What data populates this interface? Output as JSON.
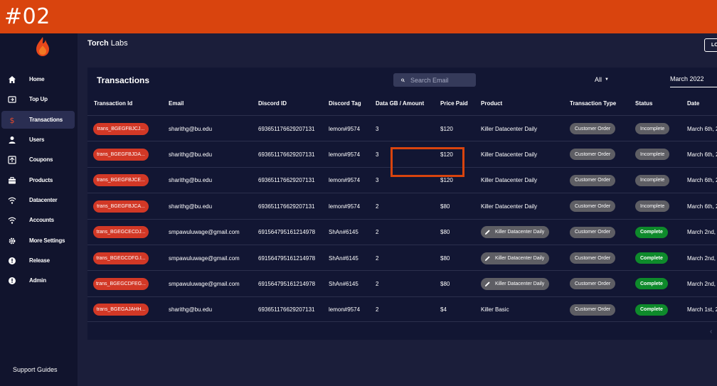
{
  "step_label": "#02",
  "brand": {
    "bold": "Torch",
    "rest": " Labs"
  },
  "logout_label": "LO",
  "sidebar": {
    "items": [
      {
        "label": "Home",
        "icon": "home-icon",
        "active": false
      },
      {
        "label": "Top Up",
        "icon": "topup-icon",
        "active": false
      },
      {
        "label": "Transactions",
        "icon": "dollar-icon",
        "active": true
      },
      {
        "label": "Users",
        "icon": "user-icon",
        "active": false
      },
      {
        "label": "Coupons",
        "icon": "coupon-icon",
        "active": false
      },
      {
        "label": "Products",
        "icon": "briefcase-icon",
        "active": false
      },
      {
        "label": "Datacenter",
        "icon": "wifi-icon",
        "active": false
      },
      {
        "label": "Accounts",
        "icon": "wifi-icon",
        "active": false
      },
      {
        "label": "More Settings",
        "icon": "gear-icon",
        "active": false
      },
      {
        "label": "Release",
        "icon": "alert-icon",
        "active": false
      },
      {
        "label": "Admin",
        "icon": "alert-icon",
        "active": false
      }
    ],
    "support_label": "Support Guides"
  },
  "transactions": {
    "title": "Transactions",
    "search_placeholder": "Search Email",
    "filter_value": "All",
    "month_value": "March 2022",
    "columns": [
      "Transaction Id",
      "Email",
      "Discord ID",
      "Discord Tag",
      "Data GB / Amount",
      "Price Paid",
      "Product",
      "Transaction Type",
      "Status",
      "Date"
    ],
    "rows": [
      {
        "id": "trans_BGEGFBJCJ...",
        "email": "sharithg@bu.edu",
        "discord_id": "693651176629207131",
        "tag": "lemon#9574",
        "amount": "3",
        "price": "$120",
        "product": "Killer Datacenter Daily",
        "product_pill": false,
        "type": "Customer Order",
        "status": "Incomplete",
        "date": "March 6th, 2"
      },
      {
        "id": "trans_BGEGFBJDA...",
        "email": "sharithg@bu.edu",
        "discord_id": "693651176629207131",
        "tag": "lemon#9574",
        "amount": "3",
        "price": "$120",
        "product": "Killer Datacenter Daily",
        "product_pill": false,
        "type": "Customer Order",
        "status": "Incomplete",
        "date": "March 6th, 2"
      },
      {
        "id": "trans_BGEGFBJCE...",
        "email": "sharithg@bu.edu",
        "discord_id": "693651176629207131",
        "tag": "lemon#9574",
        "amount": "3",
        "price": "$120",
        "product": "Killer Datacenter Daily",
        "product_pill": false,
        "type": "Customer Order",
        "status": "Incomplete",
        "date": "March 6th, 2"
      },
      {
        "id": "trans_BGEGFBJCA...",
        "email": "sharithg@bu.edu",
        "discord_id": "693651176629207131",
        "tag": "lemon#9574",
        "amount": "2",
        "price": "$80",
        "product": "Killer Datacenter Daily",
        "product_pill": false,
        "type": "Customer Order",
        "status": "Incomplete",
        "date": "March 6th, 2"
      },
      {
        "id": "trans_BGEGCECDJ...",
        "email": "smpawuluwage@gmail.com",
        "discord_id": "691564795161214978",
        "tag": "ShAn#6145",
        "amount": "2",
        "price": "$80",
        "product": "Killer Datacenter Daily",
        "product_pill": true,
        "type": "Customer Order",
        "status": "Complete",
        "date": "March 2nd, 2"
      },
      {
        "id": "trans_BGEGCDFG.I...",
        "email": "smpawuluwage@gmail.com",
        "discord_id": "691564795161214978",
        "tag": "ShAn#6145",
        "amount": "2",
        "price": "$80",
        "product": "Killer Datacenter Daily",
        "product_pill": true,
        "type": "Customer Order",
        "status": "Complete",
        "date": "March 2nd, 2"
      },
      {
        "id": "trans_BGEGCDFEG...",
        "email": "smpawuluwage@gmail.com",
        "discord_id": "691564795161214978",
        "tag": "ShAn#6145",
        "amount": "2",
        "price": "$80",
        "product": "Killer Datacenter Daily",
        "product_pill": true,
        "type": "Customer Order",
        "status": "Complete",
        "date": "March 2nd, 2"
      },
      {
        "id": "trans_BGEGAJAHH...",
        "email": "sharithg@bu.edu",
        "discord_id": "693651176629207131",
        "tag": "lemon#9574",
        "amount": "2",
        "price": "$4",
        "product": "Killer Basic",
        "product_pill": false,
        "type": "Customer Order",
        "status": "Complete",
        "date": "March 1st, 2"
      }
    ]
  },
  "colors": {
    "accent": "#d9440e",
    "red_pill": "#d23826",
    "green_pill": "#0e8a2b",
    "grey_pill": "#5e5e64"
  }
}
